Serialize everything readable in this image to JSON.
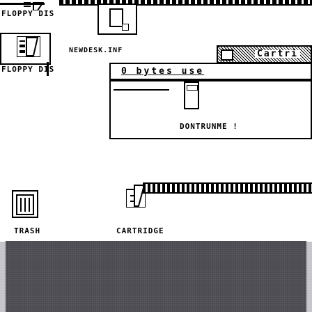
{
  "desktop": {
    "icons": {
      "floppy1": {
        "label": "FLOPPY DIS"
      },
      "floppy2": {
        "label": "FLOPPY DIS"
      },
      "trash": {
        "label": "TRASH"
      },
      "cartridge": {
        "label": "CARTRIDGE"
      }
    }
  },
  "windows": {
    "newdesk": {
      "title": "NEWDESK.INF"
    },
    "cartridge": {
      "title": "Cartri",
      "info": "0 bytes use"
    },
    "dialog": {
      "message": "DONTRUNME !"
    }
  },
  "colors": {
    "bottom_bg": "#c8c8ce",
    "bottom_frame": "#4a4a50"
  }
}
